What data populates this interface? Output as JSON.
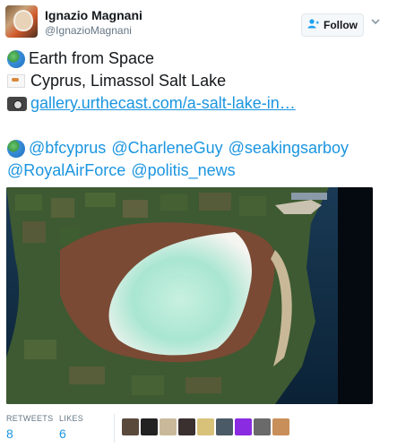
{
  "author": {
    "name": "Ignazio Magnani",
    "handle": "@IgnazioMagnani",
    "avatar_icon": "astronaut-avatar-icon"
  },
  "follow_button": {
    "label": "Follow",
    "icon": "person-add-icon"
  },
  "more_icon": "chevron-down-icon",
  "tweet": {
    "line1_icon": "globe-emoji-icon",
    "line1_text": "Earth from Space",
    "line2_icon": "cyprus-flag-emoji-icon",
    "line2_text": "Cyprus, Limassol Salt Lake",
    "line3_icon": "camera-emoji-icon",
    "link_text": "gallery.urthecast.com/a-salt-lake-in…",
    "mentions_icon": "globe-emoji-icon",
    "mentions_row1": [
      "@bfcyprus",
      "@CharleneGuy",
      "@seakingsarboy"
    ],
    "mentions_row2": [
      "@RoyalAirForce",
      "@politis_news"
    ]
  },
  "media": {
    "icon": "satellite-photo-salt-lake"
  },
  "stats": {
    "retweets_label": "RETWEETS",
    "retweets_count": "8",
    "likes_label": "LIKES",
    "likes_count": "6"
  },
  "likers_colors": [
    "#5a4a3c",
    "#222222",
    "#c9b99a",
    "#3a3030",
    "#d8c27a",
    "#4a5a66",
    "#8a2be2",
    "#6a6a6a",
    "#c98f5a"
  ],
  "colors": {
    "link": "#1b95e0",
    "follow_icon": "#1da1f2",
    "secondary_text": "#657786"
  }
}
